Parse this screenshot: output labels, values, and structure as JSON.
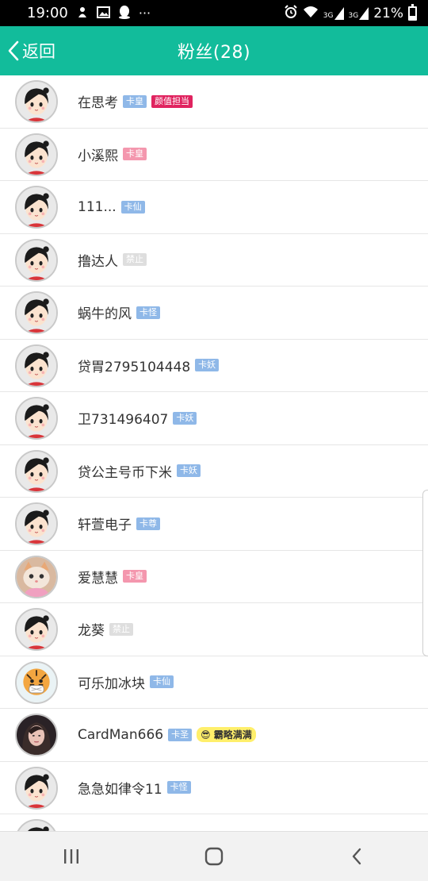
{
  "status_bar": {
    "time": "19:00",
    "notification_icons": [
      "alipay-icon",
      "gallery-icon",
      "qq-icon",
      "more-dots-icon"
    ],
    "more_dots": "···",
    "right_icons": [
      "alarm-icon",
      "wifi-icon",
      "signal-3g-icon",
      "signal-3g-icon"
    ],
    "signal_label_1": "3G",
    "signal_label_2": "3G",
    "battery": "21%"
  },
  "header": {
    "back_label": "返回",
    "title": "粉丝(28)",
    "bg_color": "#12bc9b"
  },
  "fans": [
    {
      "name": "在思考",
      "avatar": "cartoon-girl",
      "badges": [
        {
          "text": "卡皇",
          "style": "blue"
        },
        {
          "text": "颜值担当",
          "style": "red"
        }
      ]
    },
    {
      "name": "小溪熙",
      "avatar": "cartoon-girl",
      "badges": [
        {
          "text": "卡皇",
          "style": "pink"
        }
      ]
    },
    {
      "name": "111...",
      "avatar": "cartoon-girl",
      "badges": [
        {
          "text": "卡仙",
          "style": "blue"
        }
      ]
    },
    {
      "name": "撸达人",
      "avatar": "cartoon-girl",
      "badges": [
        {
          "text": "禁止",
          "style": "gray"
        }
      ]
    },
    {
      "name": "蜗牛的风",
      "avatar": "cartoon-girl",
      "badges": [
        {
          "text": "卡怪",
          "style": "blue"
        }
      ]
    },
    {
      "name": "贷胃2795104448",
      "avatar": "cartoon-girl",
      "badges": [
        {
          "text": "卡妖",
          "style": "blue"
        }
      ]
    },
    {
      "name": "卫731496407",
      "avatar": "cartoon-girl",
      "badges": [
        {
          "text": "卡妖",
          "style": "blue"
        }
      ]
    },
    {
      "name": "贷公主号币下米",
      "avatar": "cartoon-girl",
      "badges": [
        {
          "text": "卡妖",
          "style": "blue"
        }
      ]
    },
    {
      "name": "轩萱电子",
      "avatar": "cartoon-girl",
      "badges": [
        {
          "text": "卡尊",
          "style": "blue"
        }
      ]
    },
    {
      "name": "爱慧慧",
      "avatar": "cat-photo",
      "badges": [
        {
          "text": "卡皇",
          "style": "pink"
        }
      ]
    },
    {
      "name": "龙葵",
      "avatar": "cartoon-girl",
      "badges": [
        {
          "text": "禁止",
          "style": "gray"
        }
      ]
    },
    {
      "name": "可乐加冰块",
      "avatar": "tiger-drawing",
      "badges": [
        {
          "text": "卡仙",
          "style": "blue"
        }
      ]
    },
    {
      "name": "CardMan666",
      "avatar": "girl-photo",
      "badges": [
        {
          "text": "卡圣",
          "style": "blue"
        }
      ],
      "sticker": "霸略满满"
    },
    {
      "name": "急急如律令11",
      "avatar": "cartoon-girl",
      "badges": [
        {
          "text": "卡怪",
          "style": "blue"
        }
      ]
    }
  ],
  "nav": {
    "recent_icon": "recent-apps-icon",
    "home_icon": "home-icon",
    "back_icon": "back-icon"
  }
}
